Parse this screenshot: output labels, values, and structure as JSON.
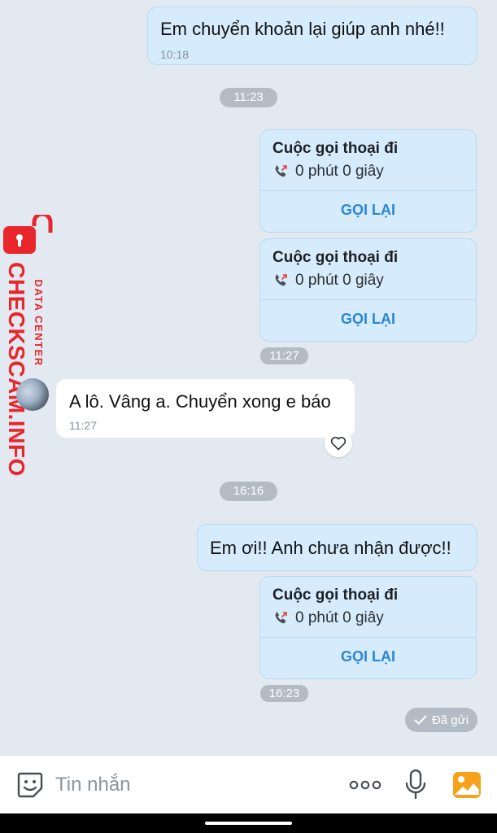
{
  "messages": {
    "m1": {
      "text": "Em chuyển khoản lại giúp anh nhé!!",
      "time": "10:18"
    },
    "divider1": "11:23",
    "call1": {
      "title": "Cuộc gọi thoại đi",
      "duration": "0 phút 0 giây",
      "action": "GỌI LẠI"
    },
    "call2": {
      "title": "Cuộc gọi thoại đi",
      "duration": "0 phút 0 giây",
      "action": "GỌI LẠI",
      "time": "11:27"
    },
    "m2": {
      "text": "A lô. Vâng a. Chuyển xong e báo",
      "time": "11:27"
    },
    "divider2": "16:16",
    "m3": {
      "text": "Em ơi!! Anh chưa nhận được!!"
    },
    "call3": {
      "title": "Cuộc gọi thoại đi",
      "duration": "0 phút 0 giây",
      "action": "GỌI LẠI",
      "time": "16:23"
    },
    "status": "Đã gửi"
  },
  "watermark": {
    "brand": "CHECKSCAM.INFO",
    "tagline": "DATA CENTER"
  },
  "composer": {
    "placeholder": "Tin nhắn"
  },
  "colors": {
    "background": "#e2e9f1",
    "outgoing_bubble": "#d6ecfd",
    "link_blue": "#2a86d8",
    "missed_red": "#e53935",
    "watermark_red": "#e8262b"
  },
  "icons": [
    "phone-outgoing-icon",
    "heart-icon",
    "check-icon",
    "sticker-icon",
    "more-icon",
    "microphone-icon",
    "gallery-icon",
    "lock-icon"
  ]
}
